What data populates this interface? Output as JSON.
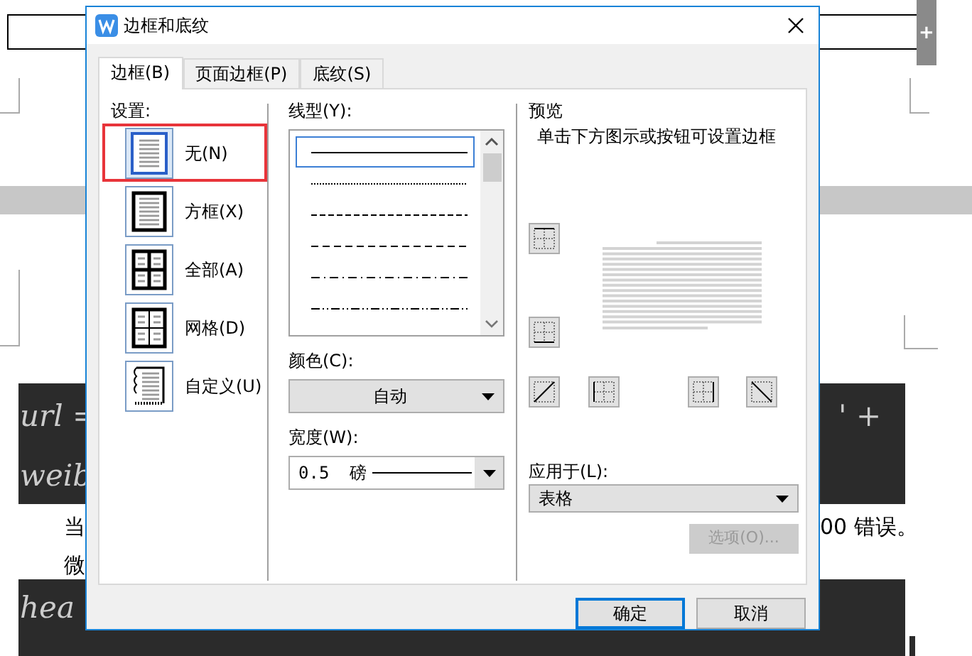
{
  "background": {
    "code_lines": [
      "url =",
      "weib",
      "hea"
    ],
    "handle_symbol": "+",
    "right_code": "' +",
    "text_lines": [
      "当",
      "微"
    ],
    "right_text": "00 错误。"
  },
  "dialog": {
    "title": "边框和底纹",
    "tabs": [
      {
        "label": "边框(B)",
        "selected": true
      },
      {
        "label": "页面边框(P)",
        "selected": false
      },
      {
        "label": "底纹(S)",
        "selected": false
      }
    ],
    "settings": {
      "label": "设置:",
      "items": [
        {
          "kind": "none",
          "label": "无(N)",
          "selected": true
        },
        {
          "kind": "box",
          "label": "方框(X)",
          "selected": false
        },
        {
          "kind": "all",
          "label": "全部(A)",
          "selected": false
        },
        {
          "kind": "grid",
          "label": "网格(D)",
          "selected": false
        },
        {
          "kind": "custom",
          "label": "自定义(U)",
          "selected": false
        }
      ]
    },
    "line_style": {
      "label": "线型(Y):",
      "styles": [
        {
          "kind": "solid",
          "selected": true
        },
        {
          "kind": "dotted",
          "selected": false
        },
        {
          "kind": "dashed",
          "selected": false
        },
        {
          "kind": "short-dash",
          "selected": false
        },
        {
          "kind": "dash-dot",
          "selected": false
        },
        {
          "kind": "dash-dot-dot",
          "selected": false
        }
      ]
    },
    "color": {
      "label": "颜色(C):",
      "value": "自动"
    },
    "width": {
      "label": "宽度(W):",
      "value": "0.5  磅"
    },
    "preview": {
      "label": "预览",
      "hint": "单击下方图示或按钮可设置边框"
    },
    "apply_to": {
      "label": "应用于(L):",
      "value": "表格"
    },
    "options_button": {
      "label": "选项(O)...",
      "disabled": true
    },
    "buttons": [
      {
        "label": "确定",
        "default": true
      },
      {
        "label": "取消",
        "default": false
      }
    ]
  }
}
